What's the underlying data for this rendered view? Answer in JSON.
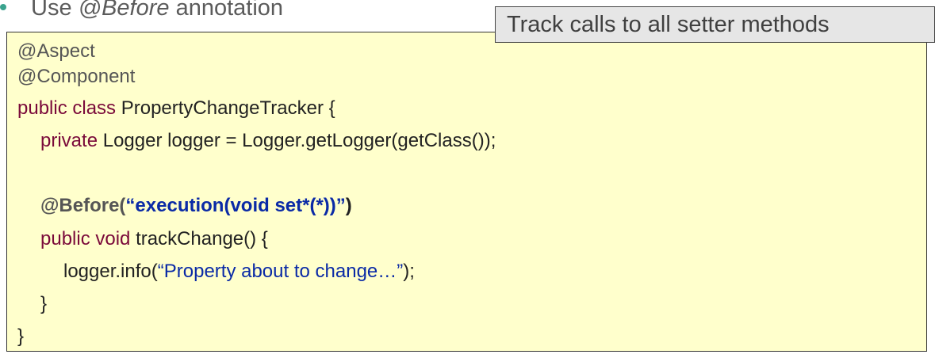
{
  "bullet": {
    "prefix": "Use ",
    "emphasis": "@Before",
    "suffix": " annotation"
  },
  "callout": {
    "text": "Track calls to all setter methods"
  },
  "code": {
    "line1": "@Aspect",
    "line2": "@Component",
    "line3_kw": "public class",
    "line3_rest": " PropertyChangeTracker {",
    "line4_kw": "private",
    "line4_rest": " Logger logger = Logger.getLogger(getClass());",
    "line5_ann": "@Before(",
    "line5_str": "“execution(void set*(*))”",
    "line5_close": ")",
    "line6_kw": "public void",
    "line6_rest": " trackChange() {",
    "line7_pre": "logger.info(",
    "line7_str": "“Property about to change…”",
    "line7_post": ");",
    "line8": "}",
    "line9": "}"
  }
}
